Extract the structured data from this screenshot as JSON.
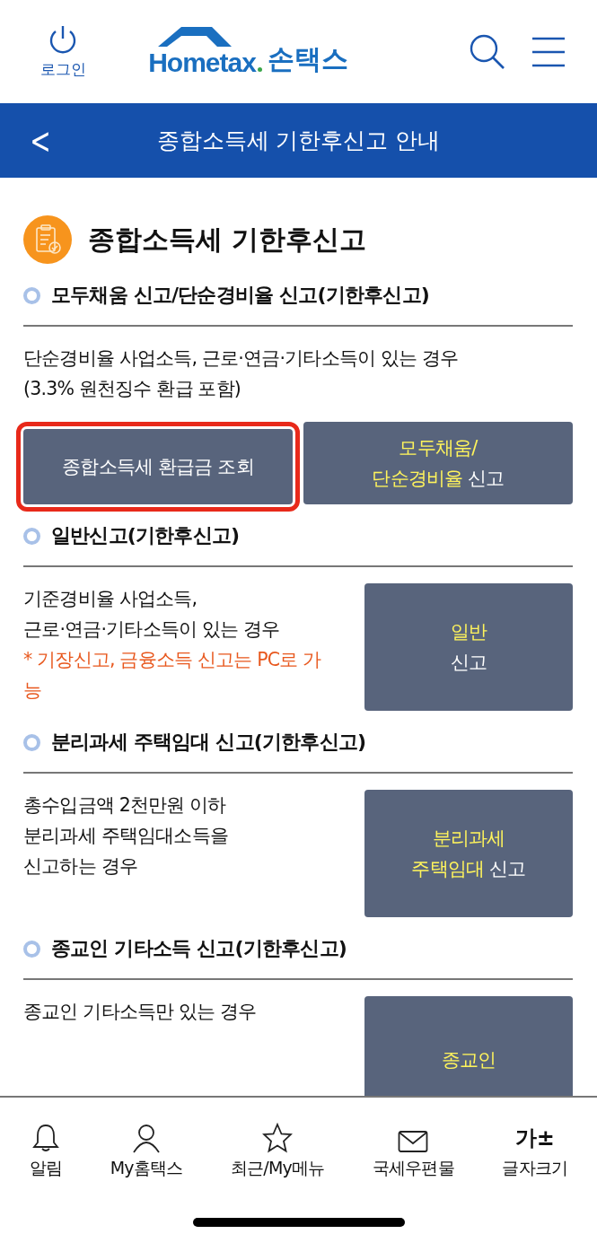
{
  "header": {
    "login_label": "로그인",
    "logo_brand": "Hometax",
    "logo_name": "손택스"
  },
  "title_bar": {
    "back": "<",
    "title": "종합소득세 기한후신고 안내"
  },
  "page_heading": "종합소득세 기한후신고",
  "sections": [
    {
      "kind": "stacked",
      "heading": "모두채움 신고/단순경비율 신고(기한후신고)",
      "description": [
        {
          "kind": "normal",
          "text": "단순경비율 사업소득, 근로·연금·기타소득이 있는 경우"
        },
        {
          "kind": "normal",
          "text": "(3.3% 원천징수 환급 포함)"
        }
      ],
      "buttons": [
        {
          "outlined": true,
          "lines": [
            [
              {
                "text": "종합소득세 환급금 조회",
                "highlight": false
              }
            ]
          ]
        },
        {
          "outlined": false,
          "lines": [
            [
              {
                "text": "모두채움/",
                "highlight": true
              }
            ],
            [
              {
                "text": "단순경비율",
                "highlight": true
              },
              {
                "text": " 신고",
                "highlight": false
              }
            ]
          ]
        }
      ]
    },
    {
      "kind": "side",
      "heading": "일반신고(기한후신고)",
      "description": [
        {
          "kind": "normal",
          "text": "기준경비율 사업소득,"
        },
        {
          "kind": "normal",
          "text": "근로·연금·기타소득이 있는 경우"
        },
        {
          "kind": "note",
          "text": "* 기장신고, 금융소득 신고는 PC로 가능"
        }
      ],
      "buttons": [
        {
          "outlined": false,
          "lines": [
            [
              {
                "text": "일반",
                "highlight": true
              }
            ],
            [
              {
                "text": "신고",
                "highlight": false
              }
            ]
          ]
        }
      ]
    },
    {
      "kind": "side",
      "heading": "분리과세 주택임대 신고(기한후신고)",
      "description": [
        {
          "kind": "normal",
          "text": "총수입금액 2천만원 이하"
        },
        {
          "kind": "normal",
          "text": "분리과세 주택임대소득을"
        },
        {
          "kind": "normal",
          "text": "신고하는 경우"
        }
      ],
      "buttons": [
        {
          "outlined": false,
          "lines": [
            [
              {
                "text": "분리과세",
                "highlight": true
              }
            ],
            [
              {
                "text": "주택임대",
                "highlight": true
              },
              {
                "text": " 신고",
                "highlight": false
              }
            ]
          ]
        }
      ]
    },
    {
      "kind": "side",
      "heading": "종교인 기타소득 신고(기한후신고)",
      "description": [
        {
          "kind": "normal",
          "text": "종교인 기타소득만 있는 경우"
        }
      ],
      "buttons": [
        {
          "outlined": false,
          "lines": [
            [
              {
                "text": "종교인",
                "highlight": true
              }
            ]
          ]
        }
      ]
    }
  ],
  "bottom_nav": [
    {
      "kind": "bell",
      "label": "알림"
    },
    {
      "kind": "person",
      "label": "My홈택스"
    },
    {
      "kind": "star",
      "label": "최근/My메뉴"
    },
    {
      "kind": "mail",
      "label": "국세우편물"
    },
    {
      "kind": "font",
      "label": "글자크기",
      "glyph": "가±"
    }
  ]
}
